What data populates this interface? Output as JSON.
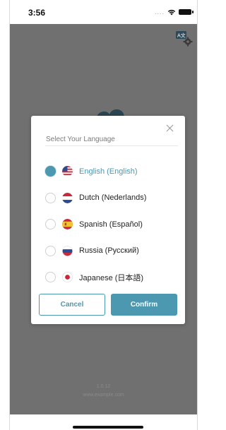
{
  "status_bar": {
    "time": "3:56",
    "signal_dots": "...."
  },
  "modal": {
    "title": "Select Your Language",
    "options": [
      {
        "label": "English (English)",
        "flag": "us-flag-icon",
        "selected": true
      },
      {
        "label": "Dutch (Nederlands)",
        "flag": "netherlands-flag-icon",
        "selected": false
      },
      {
        "label": "Spanish (Español)",
        "flag": "spain-flag-icon",
        "selected": false
      },
      {
        "label": "Russia (Русский)",
        "flag": "russia-flag-icon",
        "selected": false
      },
      {
        "label": "Japanese (日本語)",
        "flag": "japan-flag-icon",
        "selected": false
      }
    ],
    "cancel_label": "Cancel",
    "confirm_label": "Confirm"
  },
  "footer": {
    "version": "1.0.12",
    "site": "www.example.com"
  },
  "colors": {
    "accent": "#4c98b0",
    "overlay": "#707070"
  }
}
